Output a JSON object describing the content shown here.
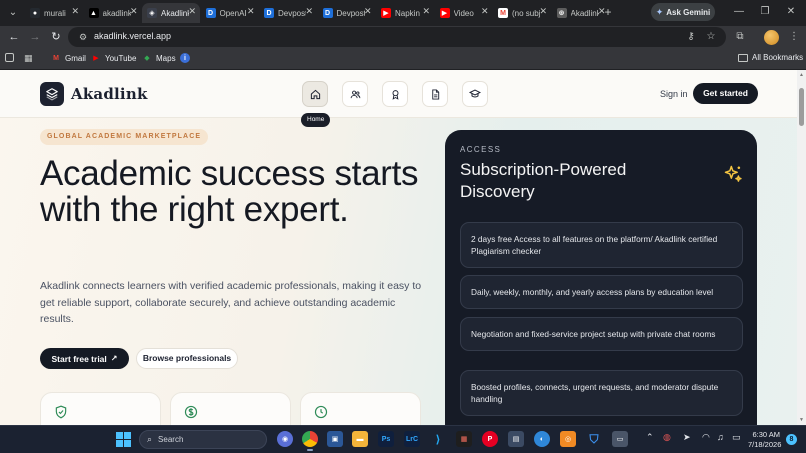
{
  "browser": {
    "tabs": [
      {
        "title": "murali",
        "favicon": "github-icon",
        "color": "#24292f",
        "glyph": "●"
      },
      {
        "title": "akadlink",
        "favicon": "vercel-icon",
        "color": "#000000",
        "glyph": "▲"
      },
      {
        "title": "Akadlink",
        "favicon": "akadlink-icon",
        "color": "#3a3f4b",
        "glyph": "◈",
        "active": true
      },
      {
        "title": "OpenAI",
        "favicon": "devin-icon",
        "color": "#1e6fd9",
        "glyph": "D"
      },
      {
        "title": "Devpost",
        "favicon": "devin-icon",
        "color": "#1e6fd9",
        "glyph": "D"
      },
      {
        "title": "Devpost",
        "favicon": "devin-icon",
        "color": "#1e6fd9",
        "glyph": "D"
      },
      {
        "title": "Napkin",
        "favicon": "youtube-icon",
        "color": "#ff0000",
        "glyph": "▶"
      },
      {
        "title": "Video",
        "favicon": "youtube-icon",
        "color": "#ff0000",
        "glyph": "▶"
      },
      {
        "title": "(no subject)",
        "favicon": "gmail-icon",
        "color": "#ffffff",
        "glyph": "M"
      },
      {
        "title": "Akadlink",
        "favicon": "chatgpt-icon",
        "color": "#5d5d5d",
        "glyph": "⊛"
      }
    ],
    "ask_gemini": "Ask Gemini",
    "url": "akadlink.vercel.app",
    "bookmarks": [
      {
        "label": "Gmail",
        "icon": "gmail-icon",
        "color": "#ea4335",
        "glyph": "M"
      },
      {
        "label": "YouTube",
        "icon": "youtube-icon",
        "color": "#ff0000",
        "glyph": "▶"
      },
      {
        "label": "Maps",
        "icon": "maps-icon",
        "color": "#34a853",
        "glyph": "◆"
      }
    ],
    "all_bookmarks": "All Bookmarks"
  },
  "site": {
    "brand": "Akadlink",
    "nav_tooltip": "Home",
    "nav_icons": [
      "home-icon",
      "users-icon",
      "award-icon",
      "document-icon",
      "graduation-cap-icon"
    ],
    "sign_in": "Sign in",
    "get_started": "Get started",
    "eyebrow": "GLOBAL ACADEMIC MARKETPLACE",
    "hero_title": "Academic success starts with the right expert.",
    "hero_sub": "Akadlink connects learners with verified academic professionals, making it easy to get reliable support, collaborate securely, and achieve outstanding academic results.",
    "cta_primary": "Start free trial",
    "cta_secondary": "Browse professionals",
    "feature_icons": [
      "shield-check-icon",
      "dollar-icon",
      "clock-icon"
    ],
    "access": {
      "eyebrow": "ACCESS",
      "title": "Subscription-Powered Discovery",
      "items": [
        "2 days free Access to all features on the platform/ Akadlink certified Plagiarism checker",
        "Daily, weekly, monthly, and yearly access plans by education level",
        "Negotiation and fixed-service project setup with private chat rooms",
        "Boosted profiles, connects, urgent requests, and moderator dispute handling"
      ]
    },
    "colors": {
      "accent_dark": "#151a24",
      "eyebrow_text": "#c1783f",
      "eyebrow_bg": "#f6e5d0",
      "spark": "#f4c542"
    }
  },
  "taskbar": {
    "search": "Search",
    "time": "6:30 AM",
    "date": "7/18/2026",
    "notification_count": "8"
  }
}
